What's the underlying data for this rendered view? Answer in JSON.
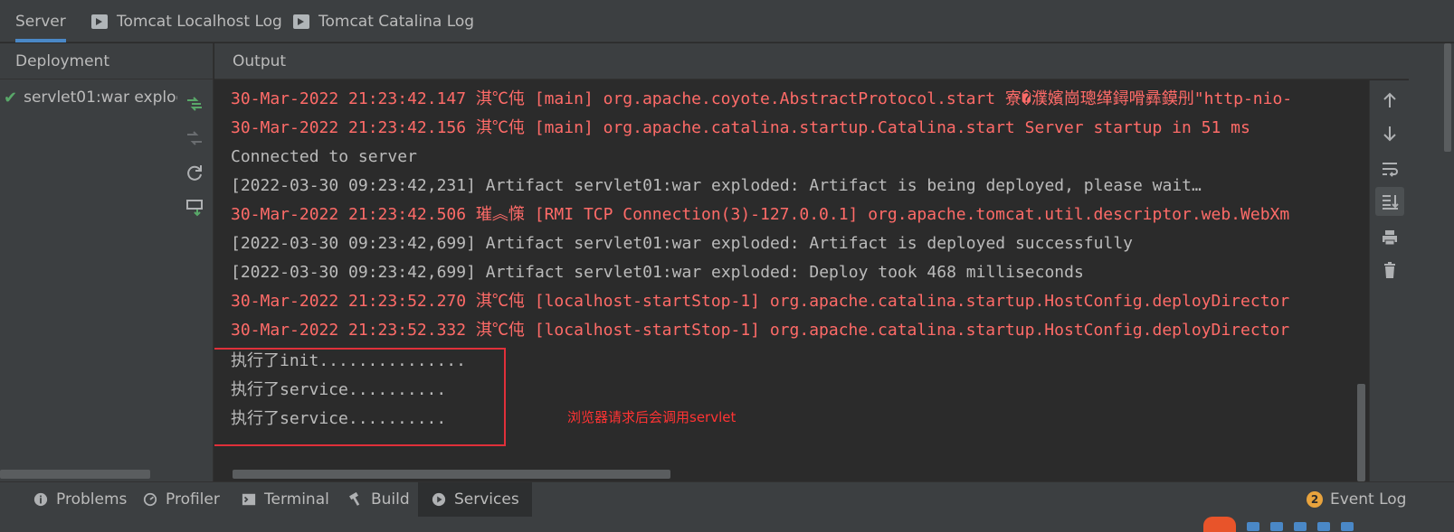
{
  "tabs": [
    {
      "label": "Server",
      "active": true,
      "icon": null
    },
    {
      "label": "Tomcat Localhost Log",
      "active": false,
      "icon": "terminal-icon"
    },
    {
      "label": "Tomcat Catalina Log",
      "active": false,
      "icon": "terminal-icon"
    }
  ],
  "deployment": {
    "header": "Deployment",
    "item": "servlet01:war exploded",
    "status_icon": "checkmark-icon"
  },
  "output": {
    "header": "Output",
    "lines": [
      {
        "text": "30-Mar-2022 21:23:42.147 淇℃伅 [main] org.apache.coyote.AbstractProtocol.start 寮�濮嬪崗璁缂鐞嗗彞鏌刐\"http-nio-",
        "type": "err"
      },
      {
        "text": "30-Mar-2022 21:23:42.156 淇℃伅 [main] org.apache.catalina.startup.Catalina.start Server startup in 51 ms",
        "type": "err"
      },
      {
        "text": "Connected to server",
        "type": "out"
      },
      {
        "text": "[2022-03-30 09:23:42,231] Artifact servlet01:war exploded: Artifact is being deployed, please wait…",
        "type": "out"
      },
      {
        "text": "30-Mar-2022 21:23:42.506 璀︽憡 [RMI TCP Connection(3)-127.0.0.1] org.apache.tomcat.util.descriptor.web.WebXm",
        "type": "err"
      },
      {
        "text": "[2022-03-30 09:23:42,699] Artifact servlet01:war exploded: Artifact is deployed successfully",
        "type": "out"
      },
      {
        "text": "[2022-03-30 09:23:42,699] Artifact servlet01:war exploded: Deploy took 468 milliseconds",
        "type": "out"
      },
      {
        "text": "30-Mar-2022 21:23:52.270 淇℃伅 [localhost-startStop-1] org.apache.catalina.startup.HostConfig.deployDirector",
        "type": "err"
      },
      {
        "text": "30-Mar-2022 21:23:52.332 淇℃伅 [localhost-startStop-1] org.apache.catalina.startup.HostConfig.deployDirector",
        "type": "err"
      },
      {
        "text": "执行了init...............",
        "type": "out"
      },
      {
        "text": "执行了service..........",
        "type": "out"
      },
      {
        "text": "执行了service..........",
        "type": "out"
      }
    ],
    "annotation": "浏览器请求后会调用servlet"
  },
  "right_toolbar": [
    "arrow-up-icon",
    "arrow-down-icon",
    "soft-wrap-icon",
    "scroll-to-end-icon",
    "print-icon",
    "trash-icon"
  ],
  "bottom_tabs": [
    {
      "label": "Problems",
      "icon": "info-icon",
      "active": false
    },
    {
      "label": "Profiler",
      "icon": "profiler-icon",
      "active": false
    },
    {
      "label": "Terminal",
      "icon": "terminal-icon",
      "active": false
    },
    {
      "label": "Build",
      "icon": "hammer-icon",
      "active": false
    },
    {
      "label": "Services",
      "icon": "services-icon",
      "active": true
    }
  ],
  "event_log": {
    "label": "Event Log",
    "count": "2"
  },
  "colors": {
    "error": "#ff6b68",
    "normal": "#bbbbbb",
    "accent": "#4a88c7",
    "annotation": "#ff3333",
    "success": "#59a869"
  }
}
